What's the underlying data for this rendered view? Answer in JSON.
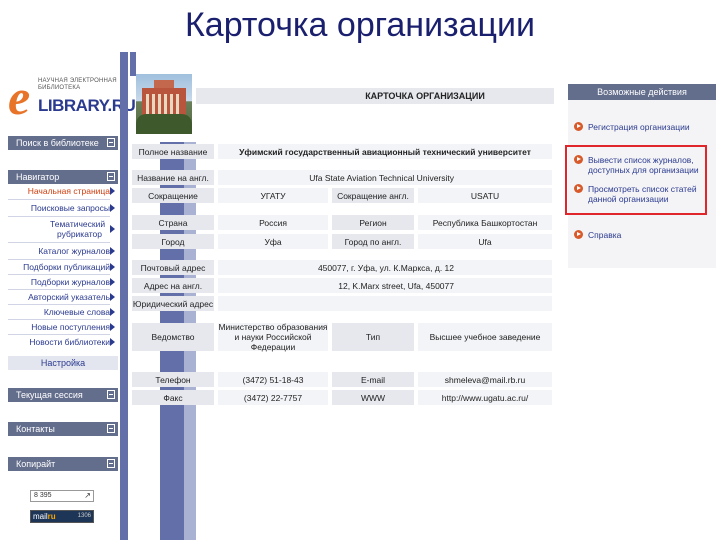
{
  "slide_title": "Карточка организации",
  "logo": {
    "line1": "научная электронная",
    "line2": "библиотека",
    "brand": "LIBRARY.RU",
    "letter": "e"
  },
  "sidebar": {
    "search_panel": "Поиск в библиотеке",
    "navigator_panel": "Навигатор",
    "nav_items": [
      "Начальная страница",
      "Поисковые запросы",
      "Тематический рубрикатор",
      "Каталог журналов",
      "Подборки публикаций",
      "Подборки журналов",
      "Авторский указатель",
      "Ключевые слова",
      "Новые поступления",
      "Новости библиотеки"
    ],
    "settings": "Настройка",
    "session_panel": "Текущая сессия",
    "contacts_panel": "Контакты",
    "copyright_panel": "Копирайт",
    "counter_text": "8 395",
    "mailru_text": "mail",
    "mailru_at": "ru",
    "mailru_count": "1306"
  },
  "card": {
    "header": "КАРТОЧКА ОРГАНИЗАЦИИ",
    "full_name_label": "Полное название",
    "full_name": "Уфимский государственный авиационный технический университет",
    "name_en_label": "Название на англ.",
    "name_en": "Ufa State Aviation Technical University",
    "abbr_label": "Сокращение",
    "abbr": "УГАТУ",
    "abbr_en_label": "Сокращение англ.",
    "abbr_en": "USATU",
    "country_label": "Страна",
    "country": "Россия",
    "region_label": "Регион",
    "region": "Республика Башкортостан",
    "city_label": "Город",
    "city": "Уфа",
    "city_en_label": "Город по англ.",
    "city_en": "Ufa",
    "postal_label": "Почтовый адрес",
    "postal": "450077, г. Уфа, ул. К.Маркса, д. 12",
    "address_en_label": "Адрес на англ.",
    "address_en": "12, K.Marx street, Ufa, 450077",
    "legal_label": "Юридический адрес",
    "legal": "",
    "dept_label": "Ведомство",
    "dept": "Министерство образования и науки Российской Федерации",
    "type_label": "Тип",
    "type": "Высшее учебное заведение",
    "phone_label": "Телефон",
    "phone": "(3472) 51-18-43",
    "email_label": "E-mail",
    "email": "shmeleva@mail.rb.ru",
    "fax_label": "Факс",
    "fax": "(3472) 22-7757",
    "www_label": "WWW",
    "www": "http://www.ugatu.ac.ru/"
  },
  "actions": {
    "title": "Возможные действия",
    "items": [
      "Регистрация организации",
      "Вывести список журналов, доступных для организации",
      "Просмотреть список статей данной организации",
      "Справка"
    ]
  },
  "colors": {
    "title": "#1a1f6e",
    "panel": "#636d8c",
    "highlight": "#e0262a",
    "logo_e": "#e8742a"
  }
}
